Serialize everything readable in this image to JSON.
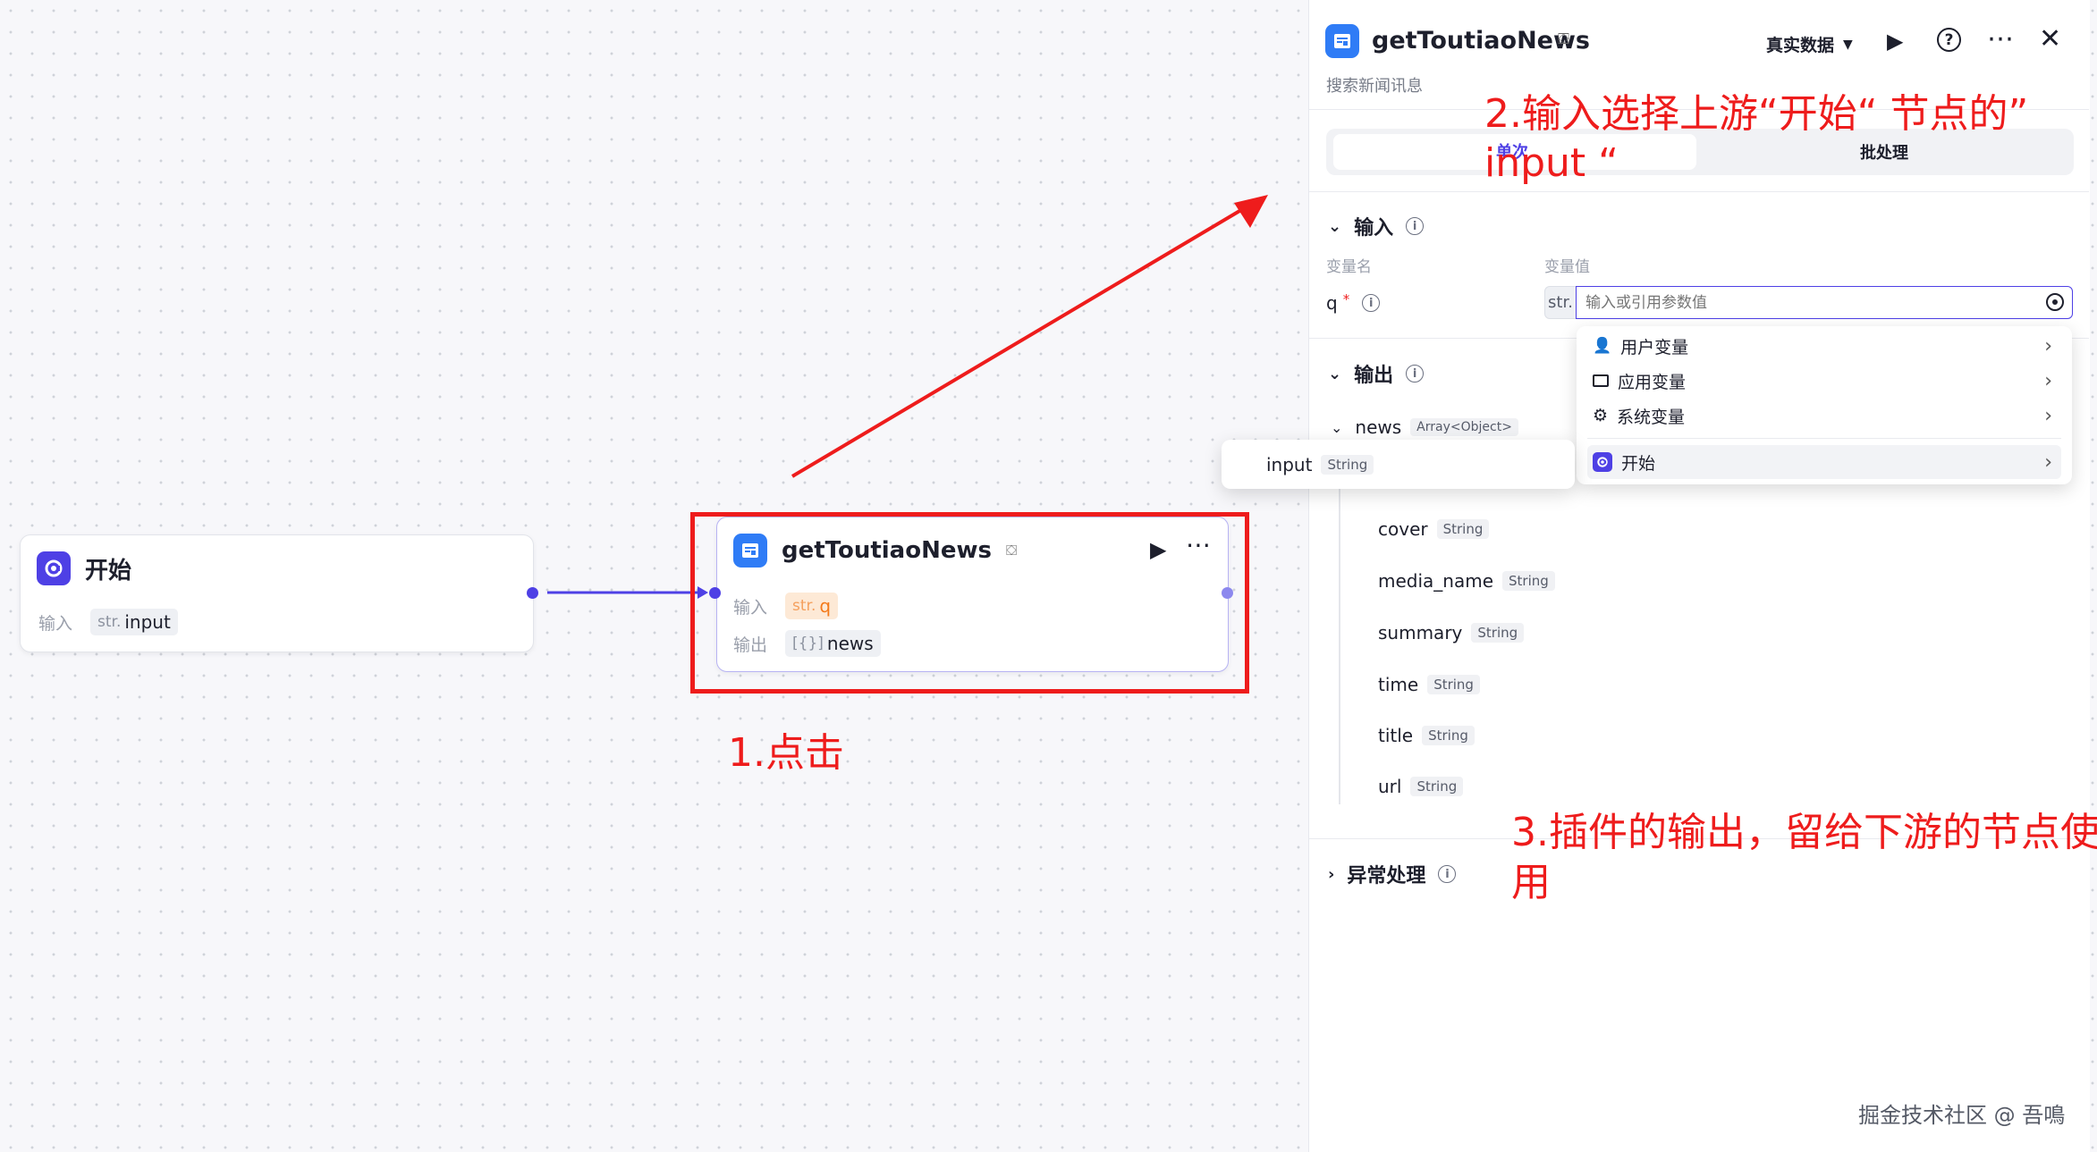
{
  "canvas": {
    "start_node": {
      "title": "开始",
      "input_label": "输入",
      "param_type": "str.",
      "param_name": "input"
    },
    "plugin_node": {
      "title": "getToutiaoNews",
      "input_label": "输入",
      "input_type": "str.",
      "input_name": "q",
      "output_label": "输出",
      "output_type": "[{}]",
      "output_name": "news"
    }
  },
  "annotations": {
    "step1": "1.点击",
    "step2_line1": "2.输入选择上游“开始“ 节点的”",
    "step2_line2": "input “",
    "step3_line1": "3.插件的输出，留给下游的节点使",
    "step3_line2": "用"
  },
  "panel": {
    "title": "getToutiaoNews",
    "description": "搜索新闻讯息",
    "data_mode": "真实数据",
    "tabs": [
      "单次",
      "批处理"
    ],
    "input_section": {
      "title": "输入",
      "col_name": "变量名",
      "col_value": "变量值",
      "param_name": "q",
      "required_mark": "*",
      "value_type": "str.",
      "value_placeholder": "输入或引用参数值"
    },
    "output_section": {
      "title": "输出",
      "root_name": "news",
      "root_type": "Array<Object>",
      "fields": [
        {
          "name": "cover",
          "type": "String"
        },
        {
          "name": "media_name",
          "type": "String"
        },
        {
          "name": "summary",
          "type": "String"
        },
        {
          "name": "time",
          "type": "String"
        },
        {
          "name": "title",
          "type": "String"
        },
        {
          "name": "url",
          "type": "String"
        }
      ]
    },
    "exception_section": {
      "title": "异常处理"
    },
    "dropdown": {
      "items": [
        {
          "label": "用户变量",
          "icon": "user-icon"
        },
        {
          "label": "应用变量",
          "icon": "folder-icon"
        },
        {
          "label": "系统变量",
          "icon": "gear-icon"
        },
        {
          "label": "开始",
          "icon": "start-node-icon"
        }
      ],
      "sub_item": {
        "name": "input",
        "type": "String"
      }
    }
  },
  "watermark": "掘金技术社区 @ 吾鳴",
  "colors": {
    "accent": "#4e40e5",
    "plugin_blue": "#2f7cf6",
    "annotation_red": "#ee1c1c",
    "warn_orange": "#f47a1a"
  }
}
